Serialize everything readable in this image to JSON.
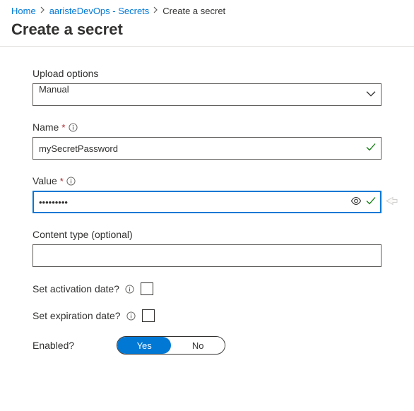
{
  "breadcrumb": {
    "home": "Home",
    "vault": "aaristeDevOps - Secrets",
    "current": "Create a secret"
  },
  "page_title": "Create a secret",
  "form": {
    "upload": {
      "label": "Upload options",
      "value": "Manual"
    },
    "name": {
      "label": "Name",
      "value": "mySecretPassword"
    },
    "value": {
      "label": "Value",
      "value": "•••••••••"
    },
    "content_type": {
      "label": "Content type (optional)",
      "value": ""
    },
    "activation": {
      "label": "Set activation date?"
    },
    "expiration": {
      "label": "Set expiration date?"
    },
    "enabled": {
      "label": "Enabled?",
      "yes": "Yes",
      "no": "No"
    }
  }
}
